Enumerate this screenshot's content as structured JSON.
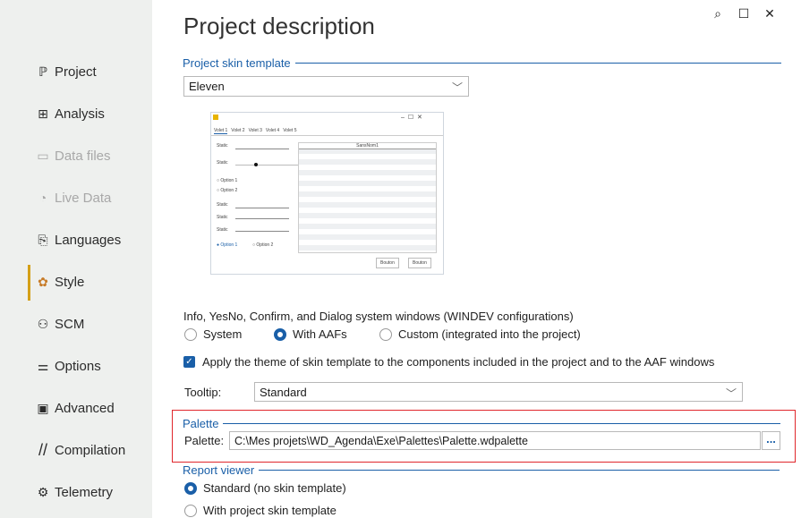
{
  "window": {
    "title": "Project description",
    "btn_help": "⌕",
    "btn_max": "☐",
    "btn_close": "✕"
  },
  "sidebar": {
    "items": [
      {
        "label": "Project",
        "icon": "project-icon",
        "glyph": "ℙ",
        "state": "normal"
      },
      {
        "label": "Analysis",
        "icon": "analysis-icon",
        "glyph": "⊞",
        "state": "normal"
      },
      {
        "label": "Data files",
        "icon": "data-files-icon",
        "glyph": "▭",
        "state": "disabled"
      },
      {
        "label": "Live Data",
        "icon": "live-data-icon",
        "glyph": "◔",
        "state": "disabled"
      },
      {
        "label": "Languages",
        "icon": "languages-icon",
        "glyph": "⎘",
        "state": "normal"
      },
      {
        "label": "Style",
        "icon": "style-palette-icon",
        "glyph": "🎨",
        "state": "active"
      },
      {
        "label": "SCM",
        "icon": "scm-icon",
        "glyph": "⚇",
        "state": "normal"
      },
      {
        "label": "Options",
        "icon": "options-icon",
        "glyph": "⚌",
        "state": "normal"
      },
      {
        "label": "Advanced",
        "icon": "advanced-icon",
        "glyph": "▣",
        "state": "normal"
      },
      {
        "label": "Compilation",
        "icon": "compilation-icon",
        "glyph": "//",
        "state": "normal"
      },
      {
        "label": "Telemetry",
        "icon": "telemetry-icon",
        "glyph": "⚙",
        "state": "normal"
      }
    ]
  },
  "skin": {
    "section": "Project skin template",
    "selected": "Eleven"
  },
  "preview": {
    "tabs": [
      "Volet 1",
      "Volet 2",
      "Volet 3",
      "Volet 4",
      "Volet 5"
    ],
    "labels": [
      "Static",
      "Static",
      "Static",
      "Static",
      "Static",
      "Static"
    ],
    "option1": "Option 1",
    "option2": "Option 2",
    "option1b": "Option 1",
    "option2b": "Option 2",
    "table_header": "SansNom1",
    "button1": "Bouton",
    "button2": "Bouton",
    "winbtns": "–  ☐  ✕"
  },
  "system_windows": {
    "label": "Info, YesNo, Confirm, and Dialog system windows (WINDEV configurations)",
    "options": [
      "System",
      "With AAFs",
      "Custom (integrated into the project)"
    ],
    "selected_index": 1
  },
  "apply_theme": {
    "label": "Apply the theme of skin template to the components included in the project and to the AAF windows",
    "checked": true
  },
  "tooltip": {
    "label": "Tooltip:",
    "value": "Standard"
  },
  "palette": {
    "section": "Palette",
    "label": "Palette:",
    "path": "C:\\Mes projets\\WD_Agenda\\Exe\\Palettes\\Palette.wdpalette",
    "browse": "..."
  },
  "report_viewer": {
    "section": "Report viewer",
    "options": [
      "Standard (no skin template)",
      "With project skin template"
    ],
    "selected_index": 0
  },
  "colors": {
    "accent": "#1a5fa8",
    "highlight_frame": "#e0262b",
    "active_marker": "#d4a017"
  }
}
